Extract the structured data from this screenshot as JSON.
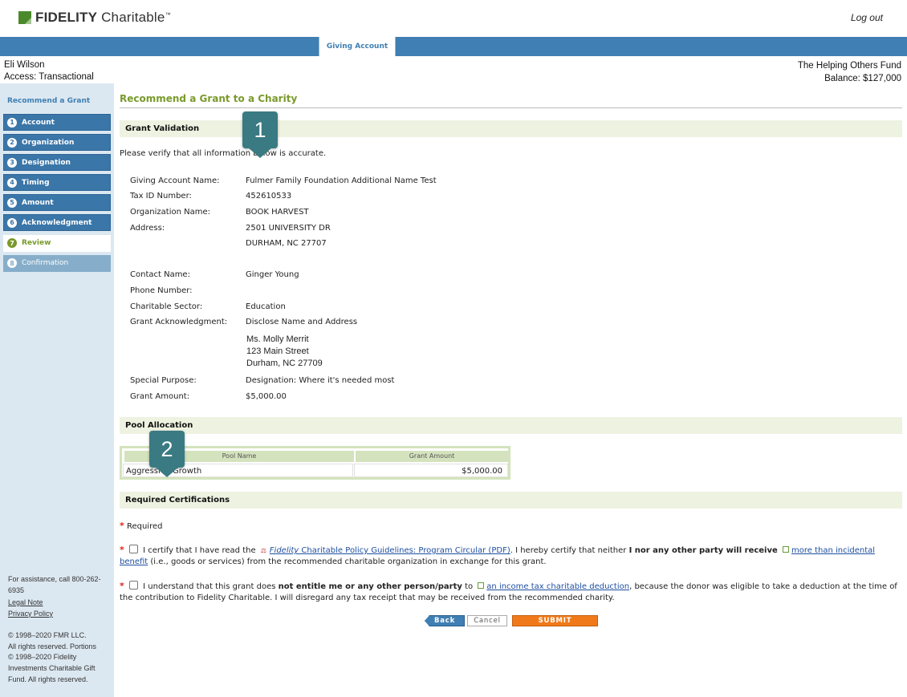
{
  "header": {
    "logo_bold": "FIDELITY",
    "logo_rest": " Charitable",
    "logo_tm": "™",
    "logout": "Log out"
  },
  "nav": {
    "tab": "Giving Account"
  },
  "user": {
    "name": "Eli Wilson",
    "access": "Access: Transactional"
  },
  "fund": {
    "name": "The Helping Others Fund",
    "balance": "Balance: $127,000"
  },
  "sidebar": {
    "title": "Recommend a Grant",
    "steps": [
      {
        "num": "1",
        "label": "Account"
      },
      {
        "num": "2",
        "label": "Organization"
      },
      {
        "num": "3",
        "label": "Designation"
      },
      {
        "num": "4",
        "label": "Timing"
      },
      {
        "num": "5",
        "label": "Amount"
      },
      {
        "num": "6",
        "label": "Acknowledgment"
      },
      {
        "num": "7",
        "label": "Review"
      },
      {
        "num": "8",
        "label": "Confirmation"
      }
    ],
    "assistance": "For assistance, call 800-262-6935",
    "legal_note": "Legal Note",
    "privacy_policy": "Privacy Policy",
    "copyright": [
      "© 1998–2020 FMR LLC.",
      "All rights reserved. Portions",
      "© 1998–2020 Fidelity",
      "Investments Charitable Gift",
      "Fund. All rights reserved."
    ]
  },
  "main": {
    "title": "Recommend a Grant to a Charity",
    "validation": {
      "heading": "Grant Validation",
      "intro": "Please verify that all information below is accurate.",
      "labels": {
        "account": "Giving Account Name:",
        "tax_id": "Tax ID Number:",
        "org": "Organization Name:",
        "address": "Address:",
        "contact": "Contact Name:",
        "phone": "Phone Number:",
        "sector": "Charitable Sector:",
        "ack": "Grant Acknowledgment:",
        "purpose": "Special Purpose:",
        "amount": "Grant Amount:"
      },
      "values": {
        "account": "Fulmer Family Foundation Additional Name Test",
        "tax_id": "452610533",
        "org": "BOOK HARVEST",
        "address1": "2501 UNIVERSITY DR",
        "address2": "DURHAM, NC 27707",
        "contact": "Ginger Young",
        "phone": "",
        "sector": "Education",
        "ack": "Disclose Name and Address",
        "ack_name": "Ms. Molly Merrit",
        "ack_street": "123 Main Street",
        "ack_city": "Durham, NC 27709",
        "purpose": "Designation: Where it's needed most",
        "amount": "$5,000.00"
      }
    },
    "pool": {
      "heading": "Pool Allocation",
      "col_name": "Pool Name",
      "col_amount": "Grant Amount",
      "row_name": "Aggressive Growth",
      "row_amount": "$5,000.00"
    },
    "certs": {
      "heading": "Required Certifications",
      "required": "Required",
      "c1_a": "I certify that I have read the",
      "c1_link_italic": "Fidelity",
      "c1_link": "Charitable Policy Guidelines: Program Circular (PDF)",
      "c1_b": ". I hereby certify that neither",
      "c1_bold": "I nor any other party will receive",
      "c1_link2": "more than incidental benefit",
      "c1_c": "(i.e., goods or services) from the recommended charitable organization in exchange for this grant.",
      "c2_a": "I understand that this grant does",
      "c2_bold": "not entitle me or any other person/party",
      "c2_b": "to",
      "c2_link": "an income tax charitable deduction",
      "c2_c": ", because the donor was eligible to take a deduction at the time of the contribution to Fidelity Charitable. I will disregard any tax receipt that may be received from the recommended charity."
    },
    "buttons": {
      "back": "Back",
      "cancel": "Cancel",
      "submit": "SUBMIT"
    }
  },
  "callouts": [
    "1",
    "2"
  ]
}
